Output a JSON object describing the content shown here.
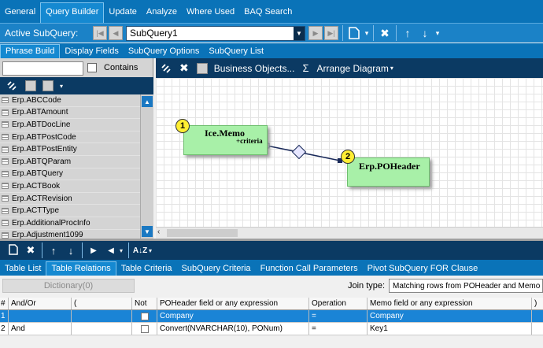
{
  "top_tabs": [
    "General",
    "Query Builder",
    "Update",
    "Analyze",
    "Where Used",
    "BAQ Search"
  ],
  "active_top_tab": "Query Builder",
  "subquery_bar": {
    "label": "Active SubQuery:",
    "selected": "SubQuery1"
  },
  "sub_tabs": [
    "Phrase Build",
    "Display Fields",
    "SubQuery Options",
    "SubQuery List"
  ],
  "active_sub_tab": "Phrase Build",
  "left_panel": {
    "search_value": "",
    "contains_label": "Contains",
    "tables": [
      "Erp.ABCCode",
      "Erp.ABTAmount",
      "Erp.ABTDocLine",
      "Erp.ABTPostCode",
      "Erp.ABTPostEntity",
      "Erp.ABTQParam",
      "Erp.ABTQuery",
      "Erp.ACTBook",
      "Erp.ACTRevision",
      "Erp.ACTType",
      "Erp.AdditionalProcInfo",
      "Erp.Adjustment1099"
    ]
  },
  "diagram_toolbar": {
    "business_objects": "Business Objects...",
    "sigma": "Σ",
    "arrange": "Arrange Diagram"
  },
  "diagram": {
    "node1": {
      "badge": "1",
      "title": "Ice.Memo",
      "criteria": "+criteria"
    },
    "node2": {
      "badge": "2",
      "title": "Erp.POHeader"
    }
  },
  "bottom_tabs": [
    "Table List",
    "Table Relations",
    "Table Criteria",
    "SubQuery Criteria",
    "Function Call Parameters",
    "Pivot SubQuery FOR Clause"
  ],
  "active_bottom_tab": "Table Relations",
  "relations": {
    "dictionary_button": "Dictionary(0)",
    "join_type_label": "Join type:",
    "join_type_value": "Matching rows from POHeader and Memo",
    "columns": [
      "#",
      "And/Or",
      "(",
      "Not",
      "POHeader field or any expression",
      "Operation",
      "Memo field or any expression",
      ")"
    ],
    "rows": [
      {
        "num": "1",
        "andor": "",
        "open": "",
        "not": false,
        "left": "Company",
        "op": "=",
        "right": "Company",
        "close": ""
      },
      {
        "num": "2",
        "andor": "And",
        "open": "",
        "not": false,
        "left": "Convert(NVARCHAR(10), PONum)",
        "op": "=",
        "right": "Key1",
        "close": ""
      }
    ]
  },
  "colors": {
    "tab_bar": "#0a73b8",
    "toolbar_dark": "#0b3a63",
    "selection": "#1a84d6",
    "node_fill": "#a8f0a8",
    "badge": "#ffee33"
  }
}
